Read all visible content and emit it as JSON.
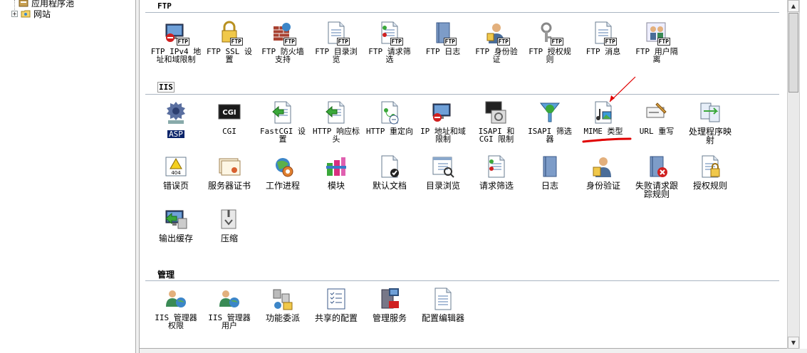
{
  "tree": {
    "items": [
      {
        "label": "应用程序池",
        "icon": "app-pool-icon"
      },
      {
        "label": "网站",
        "icon": "sites-folder-icon",
        "expander": "+"
      }
    ]
  },
  "groups": {
    "ftp": {
      "title": "FTP"
    },
    "iis": {
      "title": "IIS"
    },
    "manage": {
      "title": "管理"
    }
  },
  "features": {
    "ftp": [
      {
        "line1": "FTP IPv4 地",
        "line2": "址和域限制",
        "icon": "ftp-ipv4-icon"
      },
      {
        "line1": "FTP SSL 设",
        "line2": "置",
        "icon": "ftp-ssl-icon"
      },
      {
        "line1": "FTP 防火墙",
        "line2": "支持",
        "icon": "ftp-firewall-icon"
      },
      {
        "line1": "FTP 目录浏",
        "line2": "览",
        "icon": "ftp-directory-icon"
      },
      {
        "line1": "FTP 请求筛",
        "line2": "选",
        "icon": "ftp-request-filter-icon"
      },
      {
        "line1": "FTP 日志",
        "line2": "",
        "icon": "ftp-logging-icon"
      },
      {
        "line1": "FTP 身份验",
        "line2": "证",
        "icon": "ftp-auth-icon"
      },
      {
        "line1": "FTP 授权规",
        "line2": "则",
        "icon": "ftp-authz-icon"
      },
      {
        "line1": "FTP 消息",
        "line2": "",
        "icon": "ftp-messages-icon"
      },
      {
        "line1": "FTP 用户隔",
        "line2": "离",
        "icon": "ftp-user-isolation-icon"
      }
    ],
    "iis_row1": [
      {
        "line1": "ASP",
        "line2": "",
        "icon": "asp-icon",
        "selected": true
      },
      {
        "line1": "CGI",
        "line2": "",
        "icon": "cgi-icon"
      },
      {
        "line1": "FastCGI 设",
        "line2": "置",
        "icon": "fastcgi-icon"
      },
      {
        "line1": "HTTP 响应标",
        "line2": "头",
        "icon": "http-headers-icon"
      },
      {
        "line1": "HTTP 重定向",
        "line2": "",
        "icon": "http-redirect-icon"
      },
      {
        "line1": "IP 地址和域",
        "line2": "限制",
        "icon": "ip-restrictions-icon"
      },
      {
        "line1": "ISAPI 和",
        "line2": "CGI 限制",
        "icon": "isapi-cgi-icon"
      },
      {
        "line1": "ISAPI 筛选",
        "line2": "器",
        "icon": "isapi-filters-icon"
      },
      {
        "line1": "MIME 类型",
        "line2": "",
        "icon": "mime-types-icon"
      },
      {
        "line1": "URL 重写",
        "line2": "",
        "icon": "url-rewrite-icon"
      },
      {
        "line1": "处理程序映",
        "line2": "射",
        "icon": "handler-mappings-icon"
      }
    ],
    "iis_row2": [
      {
        "line1": "错误页",
        "line2": "",
        "icon": "error-pages-icon"
      },
      {
        "line1": "服务器证书",
        "line2": "",
        "icon": "server-certs-icon"
      },
      {
        "line1": "工作进程",
        "line2": "",
        "icon": "worker-process-icon"
      },
      {
        "line1": "模块",
        "line2": "",
        "icon": "modules-icon"
      },
      {
        "line1": "默认文档",
        "line2": "",
        "icon": "default-doc-icon"
      },
      {
        "line1": "目录浏览",
        "line2": "",
        "icon": "dir-browse-icon"
      },
      {
        "line1": "请求筛选",
        "line2": "",
        "icon": "request-filter-icon"
      },
      {
        "line1": "日志",
        "line2": "",
        "icon": "logging-icon"
      },
      {
        "line1": "身份验证",
        "line2": "",
        "icon": "authentication-icon"
      },
      {
        "line1": "失败请求跟",
        "line2": "踪规则",
        "icon": "failed-request-icon"
      },
      {
        "line1": "授权规则",
        "line2": "",
        "icon": "authorization-icon"
      }
    ],
    "iis_row3": [
      {
        "line1": "输出缓存",
        "line2": "",
        "icon": "output-cache-icon"
      },
      {
        "line1": "压缩",
        "line2": "",
        "icon": "compression-icon"
      }
    ],
    "manage": [
      {
        "line1": "IIS 管理器",
        "line2": "权限",
        "icon": "iis-mgr-perms-icon"
      },
      {
        "line1": "IIS 管理器",
        "line2": "用户",
        "icon": "iis-mgr-users-icon"
      },
      {
        "line1": "功能委派",
        "line2": "",
        "icon": "feature-delegation-icon"
      },
      {
        "line1": "共享的配置",
        "line2": "",
        "icon": "shared-config-icon"
      },
      {
        "line1": "管理服务",
        "line2": "",
        "icon": "mgmt-service-icon"
      },
      {
        "line1": "配置编辑器",
        "line2": "",
        "icon": "config-editor-icon"
      }
    ]
  },
  "badge_text": "FTP",
  "cgi_icon_text": "CGI",
  "colors": {
    "selection": "#0a246a",
    "annotation": "#e00000",
    "group_rule": "#aab5c2"
  }
}
